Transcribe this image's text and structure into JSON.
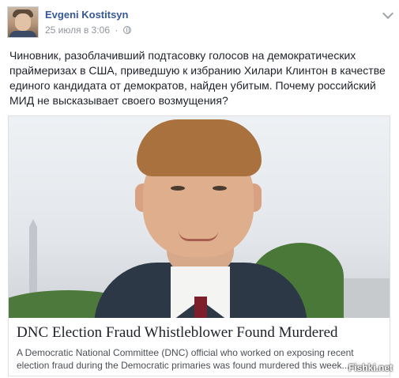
{
  "post": {
    "author": "Evgeni Kostitsyn",
    "date": "25 июля в 3:06",
    "separator": "·",
    "privacy_icon": "globe-icon",
    "menu_icon": "chevron-down-icon",
    "text": "Чиновник, разоблачивший подтасовку голосов на демократических праймеризах в США, приведшую к избранию Хилари Клинтон в качестве единого кандидата от демократов, найден убитым. Почему российский МИД не высказывает своего возмущения?"
  },
  "link_card": {
    "title": "DNC Election Fraud Whistleblower Found Murdered",
    "description": "A Democratic National Committee (DNC) official who worked on exposing recent election fraud during the Democratic primaries was found murdered this week..."
  },
  "watermark": "Fishki.net",
  "colors": {
    "author_link": "#365899",
    "meta_text": "#90949c",
    "body_text": "#1d2129"
  }
}
